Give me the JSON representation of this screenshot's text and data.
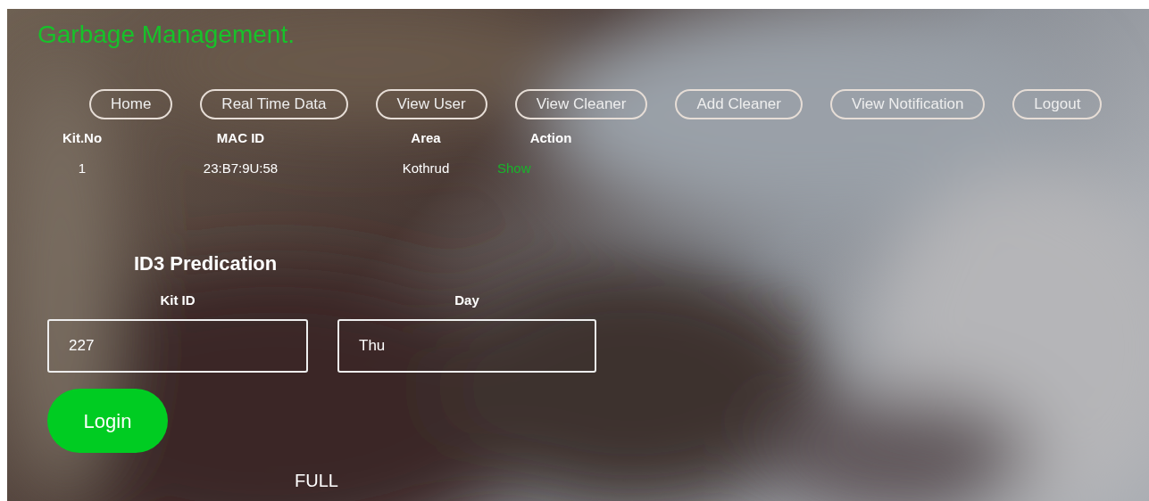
{
  "title": "Garbage Management.",
  "nav": [
    "Home",
    "Real Time Data",
    "View User",
    "View Cleaner",
    "Add Cleaner",
    "View Notification",
    "Logout"
  ],
  "table": {
    "columns": [
      "Kit.No",
      "MAC ID",
      "Area",
      "Action"
    ],
    "rows": [
      {
        "cells": [
          "1",
          "23:B7:9U:58",
          "Kothrud"
        ],
        "action": "Show"
      }
    ]
  },
  "form": {
    "heading": "ID3 Predication",
    "fields": [
      {
        "label": "Kit ID",
        "value": "227"
      },
      {
        "label": "Day",
        "value": "Thu"
      }
    ],
    "button": "Login"
  },
  "result": "FULL"
}
